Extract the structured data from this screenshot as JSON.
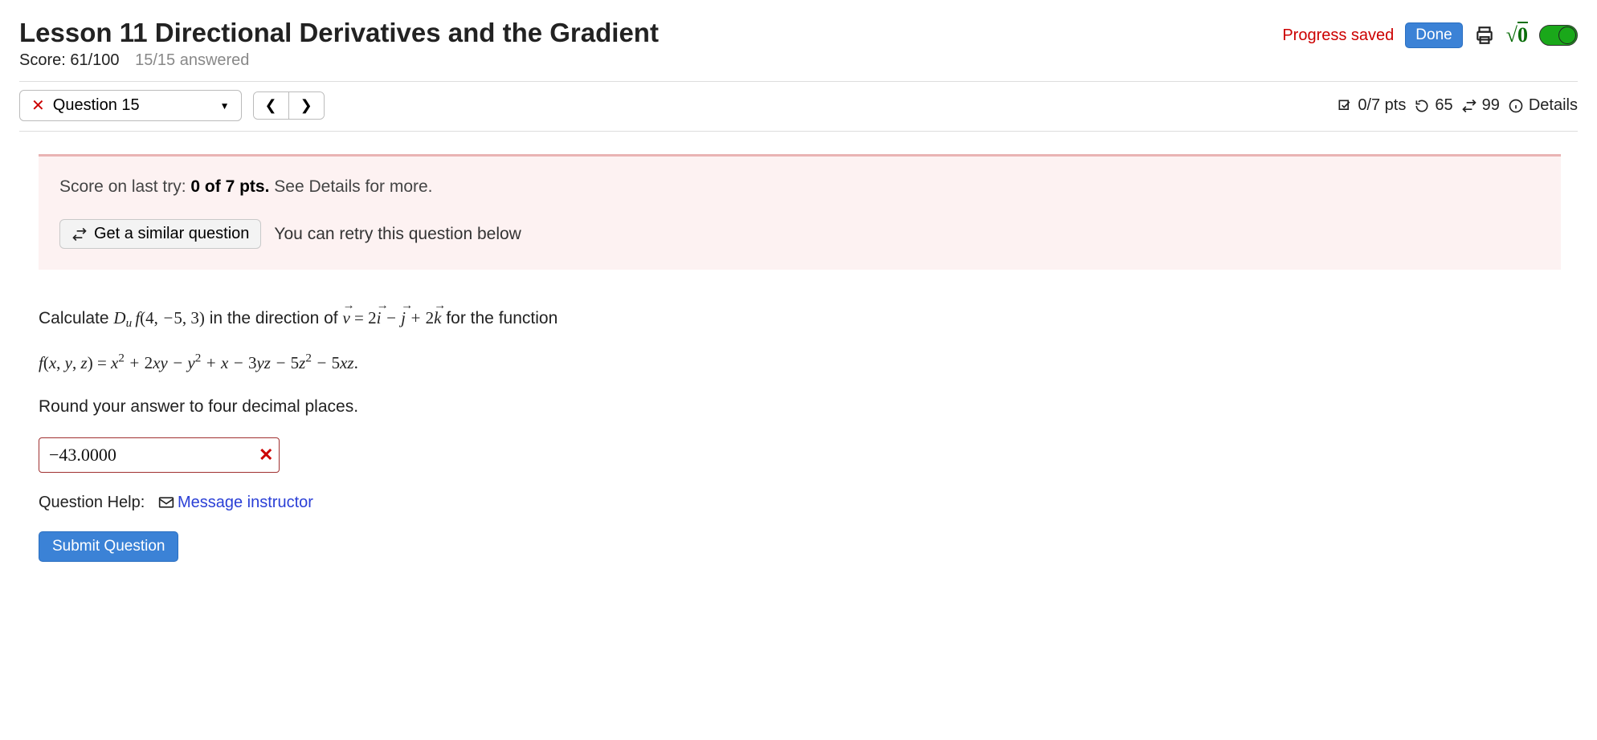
{
  "header": {
    "title": "Lesson 11 Directional Derivatives and the Gradient",
    "progress_saved": "Progress saved",
    "done_label": "Done",
    "score_label": "Score: 61/100",
    "answered_label": "15/15 answered"
  },
  "question_bar": {
    "dropdown_label": "Question 15",
    "points": "0/7 pts",
    "attempts_back": "65",
    "attempts_total": "99",
    "details_label": "Details"
  },
  "feedback": {
    "try_prefix": "Score on last try: ",
    "try_score": "0 of 7 pts.",
    "try_suffix": " See Details for more.",
    "similar_label": "Get a similar question",
    "retry_text": "You can retry this question below"
  },
  "question": {
    "calc_prefix": "Calculate ",
    "direction_text": " in the direction of ",
    "for_function_text": " for the function",
    "point": "(4, −5, 3)",
    "vector_expr": "2i⃗ − j⃗ + 2k⃗",
    "function_lhs": "f(x, y, z) = ",
    "function_rhs": "x² + 2xy − y² + x − 3yz − 5z² − 5xz.",
    "round_text": "Round your answer to four decimal places.",
    "answer_value": "−43.0000",
    "help_label": "Question Help:",
    "message_instructor": "Message instructor",
    "submit_label": "Submit Question"
  }
}
